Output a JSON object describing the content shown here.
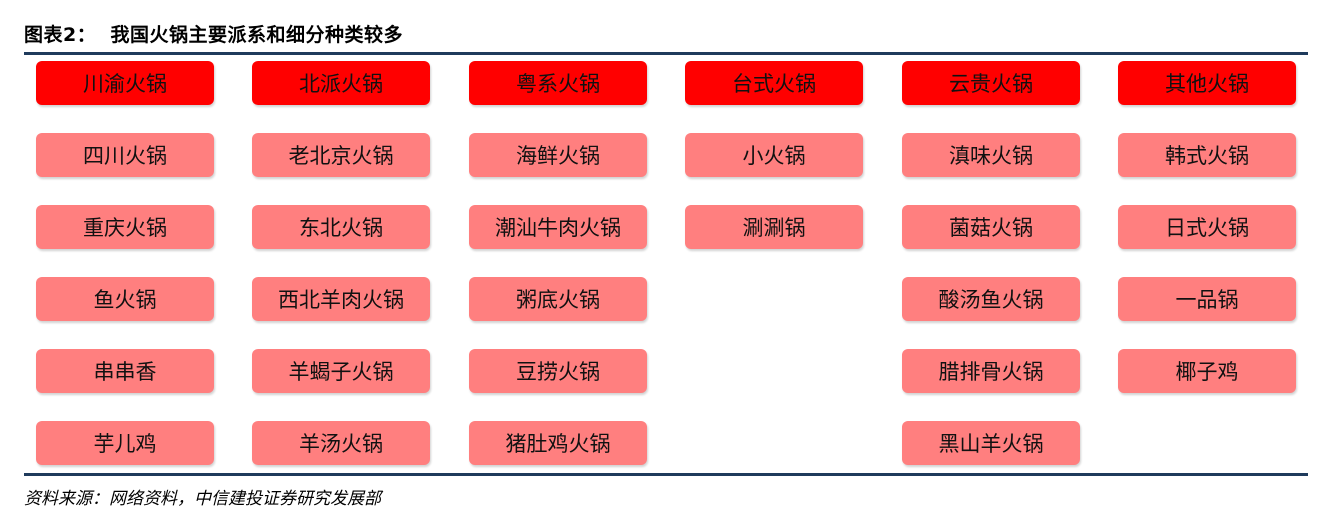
{
  "figure": {
    "title": "图表2：  我国火锅主要派系和细分种类较多",
    "source": "资料来源：网络资料，中信建投证券研究发展部"
  },
  "colors": {
    "header_tag": "#ff0000",
    "sub_tag": "#ff7f7f",
    "rule": "#1f3b5c"
  },
  "categories": [
    {
      "name": "川渝火锅",
      "items": [
        "四川火锅",
        "重庆火锅",
        "鱼火锅",
        "串串香",
        "芋儿鸡"
      ]
    },
    {
      "name": "北派火锅",
      "items": [
        "老北京火锅",
        "东北火锅",
        "西北羊肉火锅",
        "羊蝎子火锅",
        "羊汤火锅"
      ]
    },
    {
      "name": "粤系火锅",
      "items": [
        "海鲜火锅",
        "潮汕牛肉火锅",
        "粥底火锅",
        "豆捞火锅",
        "猪肚鸡火锅"
      ]
    },
    {
      "name": "台式火锅",
      "items": [
        "小火锅",
        "涮涮锅"
      ]
    },
    {
      "name": "云贵火锅",
      "items": [
        "滇味火锅",
        "菌菇火锅",
        "酸汤鱼火锅",
        "腊排骨火锅",
        "黑山羊火锅"
      ]
    },
    {
      "name": "其他火锅",
      "items": [
        "韩式火锅",
        "日式火锅",
        "一品锅",
        "椰子鸡"
      ]
    }
  ]
}
